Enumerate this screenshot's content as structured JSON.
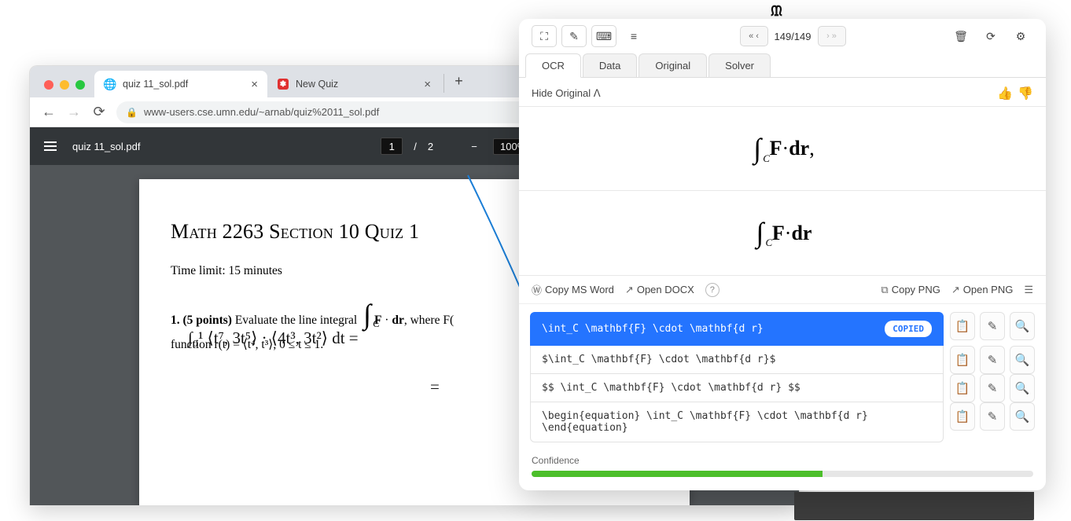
{
  "browser": {
    "tabs": [
      {
        "title": "quiz 11_sol.pdf",
        "favicon": "globe"
      },
      {
        "title": "New Quiz",
        "favicon": "red"
      }
    ],
    "url_display": "www-users.cse.umn.edu/~arnab/quiz%2011_sol.pdf"
  },
  "pdfbar": {
    "filename": "quiz 11_sol.pdf",
    "page_current": "1",
    "page_total": "2",
    "zoom": "100%"
  },
  "paper": {
    "heading": "Math 2263 Section 10 Quiz 1",
    "timelimit": "Time limit: 15 minutes",
    "q_prefix": "1.  (5 points)",
    "q_text_a": "Evaluate the line integral",
    "q_integral_tex": "∫_C F · dr,",
    "q_text_b": "where F(",
    "q_line2": "function r(t) = ⟨t⁴, t³⟩, 0 ≤ t ≤ 1.",
    "handwriting": "∫₀¹ ⟨t⁷, 3t⁵⟩ · ⟨4t³, 3t²⟩ dt  =",
    "handwriting2": "="
  },
  "panel": {
    "brand_glyph": "ᙢ",
    "pager_text": "149/149",
    "tabs": {
      "ocr": "OCR",
      "data": "Data",
      "original": "Original",
      "solver": "Solver"
    },
    "hide_original": "Hide Original",
    "equation_display_1": "∫_C F · dr,",
    "equation_display_2": "∫_C F · dr",
    "actions": {
      "copy_msword": "Copy MS Word",
      "open_docx": "Open DOCX",
      "copy_png": "Copy PNG",
      "open_png": "Open PNG"
    },
    "results": [
      {
        "code": "\\int_C \\mathbf{F} \\cdot \\mathbf{d r}",
        "copied": true
      },
      {
        "code": "$\\int_C \\mathbf{F} \\cdot \\mathbf{d r}$"
      },
      {
        "code": "$$ \\int_C \\mathbf{F} \\cdot \\mathbf{d r} $$"
      },
      {
        "code": "\\begin{equation} \\int_C \\mathbf{F} \\cdot \\mathbf{d r} \\end{equation}"
      }
    ],
    "copied_label": "COPIED",
    "confidence_label": "Confidence",
    "confidence_pct": 58
  }
}
